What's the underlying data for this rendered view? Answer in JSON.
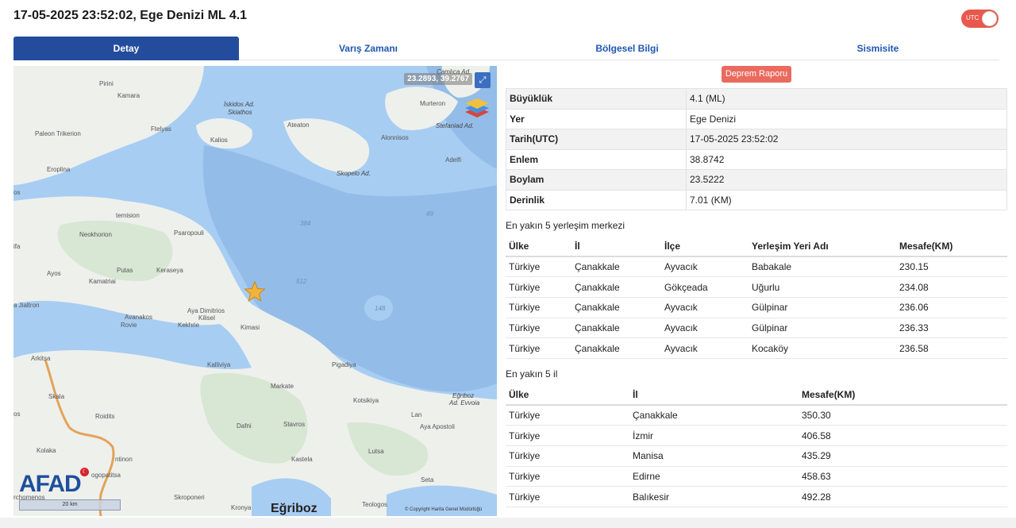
{
  "header": {
    "title": "17-05-2025 23:52:02, Ege Denizi ML 4.1",
    "utc_label": "UTC"
  },
  "tabs": [
    {
      "label": "Detay"
    },
    {
      "label": "Varış Zamanı"
    },
    {
      "label": "Bölgesel Bilgi"
    },
    {
      "label": "Sismisite"
    }
  ],
  "map": {
    "coordinates": "23.2893, 39.2767",
    "region_label": "Eğriboz",
    "scale_label": "20 km",
    "logo": "AFAD",
    "copyright": "© Copyright Harita Genel Müdürlüğü",
    "icons": [
      "expand-icon",
      "layers-icon",
      "star-epicenter-icon"
    ],
    "labels": {
      "pirini": "Pirini",
      "kamara": "Kamara",
      "iskidos": "İskidos Ad.",
      "skiathos": "Skiathos",
      "camlica": "Çamlıca Ad.",
      "murteron": "Murteron",
      "stefaniad": "Stefaniad Ad.",
      "paleon": "Paleon Trikerion",
      "ftelyas": "Ftelyas",
      "ateaton": "Ateaton",
      "alonnisos": "Alonnisos",
      "kalios": "Kalios",
      "adelfi": "Adelfi",
      "eroplina": "Eroplina",
      "skopelo": "Skopelo Ad.",
      "os1": "os",
      "temision": "temision",
      "d384": "384",
      "d49": "49",
      "neokhorion": "Neokhorion",
      "psaropouli": "Psaropouli",
      "ifa": "ifa",
      "d512": "512",
      "ayos": "Ayos",
      "putas": "Putas",
      "keraseya": "Keraseya",
      "kamatriai": "Kamatriai",
      "jialtron": "a Jialtron",
      "ayadimitrios": "Aya Dimitrios",
      "kilisel": "Kilisel",
      "d148": "148",
      "avanakos": "Avanakos",
      "rovie": "Rovie",
      "kekhrie": "Kekhrie",
      "kimasi": "Kimasi",
      "arkitsa": "Arkitsa",
      "kalliviya": "Kalliviya",
      "pigadiya": "Pigadiya",
      "markate": "Markate",
      "skala": "Skala",
      "egriboz_ad": "Eğriboz",
      "evvoia": "Ad. Evvoia",
      "kotsikiya": "Kotsikiya",
      "os2": "os",
      "roidits": "Roidits",
      "lan": "Lan",
      "dafni": "Dafni",
      "stavros": "Stavros",
      "ayaapostoli": "Aya Apostoli",
      "kolaka": "Kolaka",
      "atinon": "ntinon",
      "kastela": "Kastela",
      "lutsa": "Lutsa",
      "ogopatitsa": "ogopatitsa",
      "seta": "Seta",
      "chomenos": "rchomenos",
      "skroponeri": "Skroponeri",
      "kronya": "Kronya",
      "teologos": "Teologos"
    }
  },
  "report_button": "Deprem Raporu",
  "details": [
    {
      "key": "Büyüklük",
      "value": "4.1 (ML)"
    },
    {
      "key": "Yer",
      "value": "Ege Denizi"
    },
    {
      "key": "Tarih(UTC)",
      "value": "17-05-2025 23:52:02"
    },
    {
      "key": "Enlem",
      "value": "38.8742"
    },
    {
      "key": "Boylam",
      "value": "23.5222"
    },
    {
      "key": "Derinlik",
      "value": "7.01 (KM)"
    }
  ],
  "settlements": {
    "title": "En yakın 5 yerleşim merkezi",
    "headers": [
      "Ülke",
      "İl",
      "İlçe",
      "Yerleşim Yeri Adı",
      "Mesafe(KM)"
    ],
    "rows": [
      [
        "Türkiye",
        "Çanakkale",
        "Ayvacık",
        "Babakale",
        "230.15"
      ],
      [
        "Türkiye",
        "Çanakkale",
        "Gökçeada",
        "Uğurlu",
        "234.08"
      ],
      [
        "Türkiye",
        "Çanakkale",
        "Ayvacık",
        "Gülpinar",
        "236.06"
      ],
      [
        "Türkiye",
        "Çanakkale",
        "Ayvacık",
        "Gülpinar",
        "236.33"
      ],
      [
        "Türkiye",
        "Çanakkale",
        "Ayvacık",
        "Kocaköy",
        "236.58"
      ]
    ]
  },
  "provinces": {
    "title": "En yakın 5 il",
    "headers": [
      "Ülke",
      "İl",
      "Mesafe(KM)"
    ],
    "rows": [
      [
        "Türkiye",
        "Çanakkale",
        "350.30"
      ],
      [
        "Türkiye",
        "İzmir",
        "406.58"
      ],
      [
        "Türkiye",
        "Manisa",
        "435.29"
      ],
      [
        "Türkiye",
        "Edirne",
        "458.63"
      ],
      [
        "Türkiye",
        "Balıkesir",
        "492.28"
      ]
    ]
  },
  "colors": {
    "tab_active": "#234d9c",
    "tab_text": "#1e57b3",
    "accent_red": "#e8584d",
    "sea": "#a8cdf2",
    "land": "#eef0ec"
  }
}
